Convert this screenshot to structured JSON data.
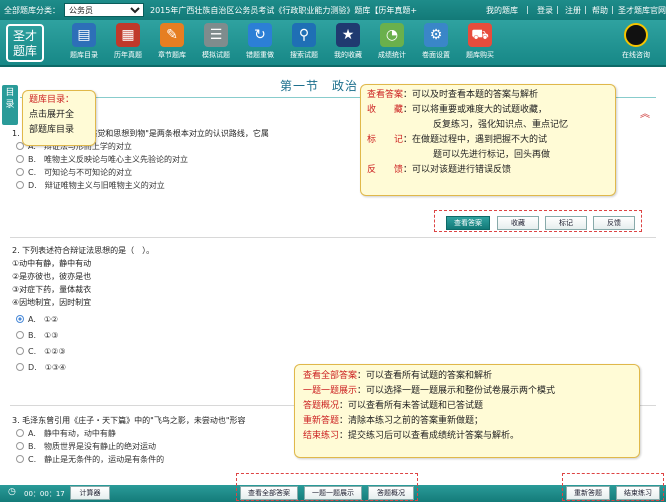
{
  "topbar": {
    "category_label": "全部题库分类：",
    "category_value": "公务员",
    "exam_title": "2015年广西壮族自治区公务员考试《行政职业能力测验》题库【历年真题+",
    "links": [
      "我的题库",
      "登录",
      "注册",
      "帮助",
      "圣才题库官网"
    ],
    "separators": [
      "|",
      "|",
      "|",
      "|"
    ]
  },
  "toolbar": {
    "logo_line1": "圣才",
    "logo_line2": "题库",
    "tools": [
      {
        "label": "题库目录",
        "icon": "catalog-icon",
        "color": "#2d6fb8",
        "glyph": "▤"
      },
      {
        "label": "历年真题",
        "icon": "past-exam-icon",
        "color": "#c0392b",
        "glyph": "▦"
      },
      {
        "label": "章节题库",
        "icon": "chapter-icon",
        "color": "#e67e22",
        "glyph": "✎"
      },
      {
        "label": "模拟试题",
        "icon": "mock-test-icon",
        "color": "#7f8c8d",
        "glyph": "☰"
      },
      {
        "label": "错题重做",
        "icon": "redo-icon",
        "color": "#2c7fd6",
        "glyph": "↻"
      },
      {
        "label": "搜索试题",
        "icon": "search-icon",
        "color": "#1f6fb5",
        "glyph": "⚲"
      },
      {
        "label": "我的收藏",
        "icon": "favorite-icon",
        "color": "#203a70",
        "glyph": "★"
      },
      {
        "label": "成绩统计",
        "icon": "stats-icon",
        "color": "#6ab04c",
        "glyph": "◔"
      },
      {
        "label": "卷面设置",
        "icon": "settings-icon",
        "color": "#3a86c8",
        "glyph": "⚙"
      },
      {
        "label": "题库购买",
        "icon": "cart-icon",
        "color": "#e74c3c",
        "glyph": "⛟"
      }
    ],
    "qq_label": "在线咨询"
  },
  "content": {
    "side_tab": "目录",
    "section_title": "第一节　政治",
    "collapse": "︽",
    "q1": {
      "stem": "1. \"存在和思维\"与\"从感觉和思想到物\"是两条根本对立的认识路线，它属",
      "options": [
        "A.　辩证法与形而上学的对立",
        "B.　唯物主义反映论与唯心主义先验论的对立",
        "C.　可知论与不可知论的对立",
        "D.　辩证唯物主义与旧唯物主义的对立"
      ],
      "buttons": [
        "查看答案",
        "收藏",
        "标记",
        "反馈"
      ]
    },
    "q2": {
      "stem": "2. 下列表述符合辩证法思想的是（　）。",
      "lines": [
        "①动中有静，静中有动",
        "②是亦彼也，彼亦是也",
        "③对症下药，量体裁衣",
        "④因地制宜，因时制宜"
      ],
      "options": [
        "A.　①②",
        "B.　①③",
        "C.　①②③",
        "D.　①③④"
      ]
    },
    "q3": {
      "stem": "3. 毛泽东曾引用《庄子・天下篇》中的\"飞鸟之影，未尝动也\"形容",
      "options": [
        "A.　静中有动，动中有静",
        "B.　物质世界是没有静止的绝对运动",
        "C.　静止是无条件的，运动是有条件的"
      ]
    }
  },
  "callouts": {
    "catalog": {
      "title": "题库目录：",
      "line1": "点击展开全",
      "line2": "部题库目录"
    },
    "answer_tools": [
      {
        "key": "查看答案",
        "text": "：可以及时查看本题的答案与解析"
      },
      {
        "key": "收　　藏",
        "text": "：可以将重要或难度大的试题收藏，"
      },
      {
        "key": "",
        "text": "反复练习，强化知识点、重点记忆"
      },
      {
        "key": "标　　记",
        "text": "：在做题过程中，遇到把握不大的试"
      },
      {
        "key": "",
        "text": "题可以先进行标记，回头再做"
      },
      {
        "key": "反　　馈",
        "text": "：可以对该题进行错误反馈"
      }
    ],
    "bottom_tools": [
      {
        "key": "查看全部答案",
        "text": "：可以查看所有试题的答案和解析"
      },
      {
        "key": "一题一题展示",
        "text": "：可以选择一题一题展示和整份试卷展示两个模式"
      },
      {
        "key": "答题概况",
        "text": "：可以查看所有未答试题和已答试题"
      },
      {
        "key": "重新答题",
        "text": "：清除本练习之前的答案重新做题；"
      },
      {
        "key": "结束练习",
        "text": "：提交练习后可以查看成绩统计答案与解析。"
      }
    ]
  },
  "bottombar": {
    "timer": "00：00：17",
    "calculator": "计算器",
    "buttons": [
      "查看全部答案",
      "一题一题展示",
      "答题概况"
    ],
    "right_buttons": [
      "重新答题",
      "结束练习"
    ]
  },
  "colors": {
    "accent": "#1e8c8a",
    "callout_bg": "#fffbd6",
    "key_red": "#cc2222"
  }
}
